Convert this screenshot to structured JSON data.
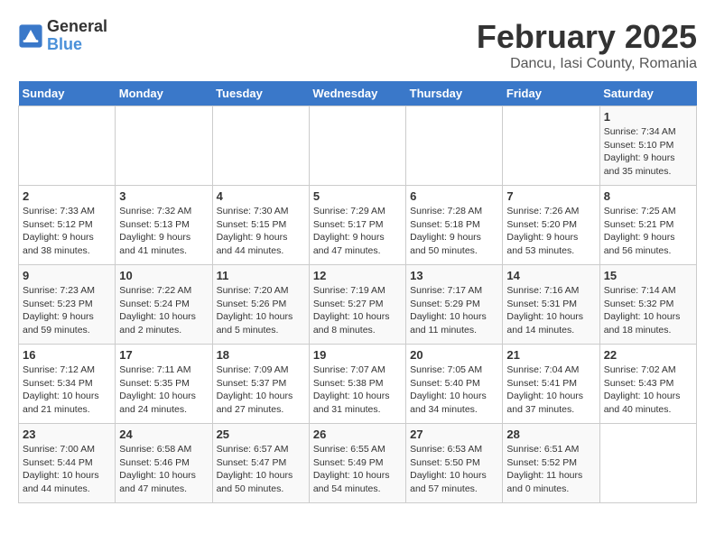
{
  "header": {
    "logo_text_general": "General",
    "logo_text_blue": "Blue",
    "month_title": "February 2025",
    "location": "Dancu, Iasi County, Romania"
  },
  "days_of_week": [
    "Sunday",
    "Monday",
    "Tuesday",
    "Wednesday",
    "Thursday",
    "Friday",
    "Saturday"
  ],
  "weeks": [
    {
      "days": [
        {
          "number": "",
          "info": ""
        },
        {
          "number": "",
          "info": ""
        },
        {
          "number": "",
          "info": ""
        },
        {
          "number": "",
          "info": ""
        },
        {
          "number": "",
          "info": ""
        },
        {
          "number": "",
          "info": ""
        },
        {
          "number": "1",
          "info": "Sunrise: 7:34 AM\nSunset: 5:10 PM\nDaylight: 9 hours and 35 minutes."
        }
      ]
    },
    {
      "days": [
        {
          "number": "2",
          "info": "Sunrise: 7:33 AM\nSunset: 5:12 PM\nDaylight: 9 hours and 38 minutes."
        },
        {
          "number": "3",
          "info": "Sunrise: 7:32 AM\nSunset: 5:13 PM\nDaylight: 9 hours and 41 minutes."
        },
        {
          "number": "4",
          "info": "Sunrise: 7:30 AM\nSunset: 5:15 PM\nDaylight: 9 hours and 44 minutes."
        },
        {
          "number": "5",
          "info": "Sunrise: 7:29 AM\nSunset: 5:17 PM\nDaylight: 9 hours and 47 minutes."
        },
        {
          "number": "6",
          "info": "Sunrise: 7:28 AM\nSunset: 5:18 PM\nDaylight: 9 hours and 50 minutes."
        },
        {
          "number": "7",
          "info": "Sunrise: 7:26 AM\nSunset: 5:20 PM\nDaylight: 9 hours and 53 minutes."
        },
        {
          "number": "8",
          "info": "Sunrise: 7:25 AM\nSunset: 5:21 PM\nDaylight: 9 hours and 56 minutes."
        }
      ]
    },
    {
      "days": [
        {
          "number": "9",
          "info": "Sunrise: 7:23 AM\nSunset: 5:23 PM\nDaylight: 9 hours and 59 minutes."
        },
        {
          "number": "10",
          "info": "Sunrise: 7:22 AM\nSunset: 5:24 PM\nDaylight: 10 hours and 2 minutes."
        },
        {
          "number": "11",
          "info": "Sunrise: 7:20 AM\nSunset: 5:26 PM\nDaylight: 10 hours and 5 minutes."
        },
        {
          "number": "12",
          "info": "Sunrise: 7:19 AM\nSunset: 5:27 PM\nDaylight: 10 hours and 8 minutes."
        },
        {
          "number": "13",
          "info": "Sunrise: 7:17 AM\nSunset: 5:29 PM\nDaylight: 10 hours and 11 minutes."
        },
        {
          "number": "14",
          "info": "Sunrise: 7:16 AM\nSunset: 5:31 PM\nDaylight: 10 hours and 14 minutes."
        },
        {
          "number": "15",
          "info": "Sunrise: 7:14 AM\nSunset: 5:32 PM\nDaylight: 10 hours and 18 minutes."
        }
      ]
    },
    {
      "days": [
        {
          "number": "16",
          "info": "Sunrise: 7:12 AM\nSunset: 5:34 PM\nDaylight: 10 hours and 21 minutes."
        },
        {
          "number": "17",
          "info": "Sunrise: 7:11 AM\nSunset: 5:35 PM\nDaylight: 10 hours and 24 minutes."
        },
        {
          "number": "18",
          "info": "Sunrise: 7:09 AM\nSunset: 5:37 PM\nDaylight: 10 hours and 27 minutes."
        },
        {
          "number": "19",
          "info": "Sunrise: 7:07 AM\nSunset: 5:38 PM\nDaylight: 10 hours and 31 minutes."
        },
        {
          "number": "20",
          "info": "Sunrise: 7:05 AM\nSunset: 5:40 PM\nDaylight: 10 hours and 34 minutes."
        },
        {
          "number": "21",
          "info": "Sunrise: 7:04 AM\nSunset: 5:41 PM\nDaylight: 10 hours and 37 minutes."
        },
        {
          "number": "22",
          "info": "Sunrise: 7:02 AM\nSunset: 5:43 PM\nDaylight: 10 hours and 40 minutes."
        }
      ]
    },
    {
      "days": [
        {
          "number": "23",
          "info": "Sunrise: 7:00 AM\nSunset: 5:44 PM\nDaylight: 10 hours and 44 minutes."
        },
        {
          "number": "24",
          "info": "Sunrise: 6:58 AM\nSunset: 5:46 PM\nDaylight: 10 hours and 47 minutes."
        },
        {
          "number": "25",
          "info": "Sunrise: 6:57 AM\nSunset: 5:47 PM\nDaylight: 10 hours and 50 minutes."
        },
        {
          "number": "26",
          "info": "Sunrise: 6:55 AM\nSunset: 5:49 PM\nDaylight: 10 hours and 54 minutes."
        },
        {
          "number": "27",
          "info": "Sunrise: 6:53 AM\nSunset: 5:50 PM\nDaylight: 10 hours and 57 minutes."
        },
        {
          "number": "28",
          "info": "Sunrise: 6:51 AM\nSunset: 5:52 PM\nDaylight: 11 hours and 0 minutes."
        },
        {
          "number": "",
          "info": ""
        }
      ]
    }
  ]
}
